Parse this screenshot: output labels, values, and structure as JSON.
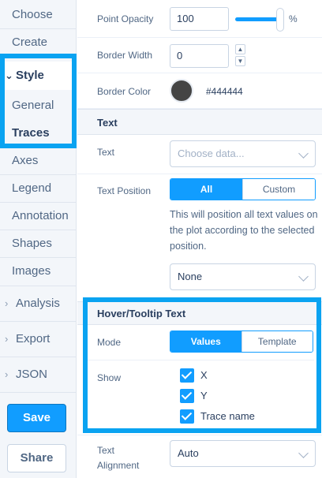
{
  "sidebar": {
    "items": {
      "choose": "Choose",
      "create": "Create",
      "style": "Style",
      "general": "General",
      "traces": "Traces",
      "axes": "Axes",
      "legend": "Legend",
      "annotation": "Annotation",
      "shapes": "Shapes",
      "images": "Images",
      "analysis": "Analysis",
      "export": "Export",
      "json": "JSON"
    },
    "save_label": "Save",
    "share_label": "Share"
  },
  "panel": {
    "point_opacity": {
      "label": "Point Opacity",
      "value": "100",
      "unit": "%",
      "slider_level": 1.0
    },
    "border_width": {
      "label": "Border Width",
      "value": "0"
    },
    "border_color": {
      "label": "Border Color",
      "hex": "#444444"
    },
    "text_section": {
      "title": "Text",
      "text_label": "Text",
      "text_placeholder": "Choose data...",
      "position_label": "Text Position",
      "position_options": [
        "All",
        "Custom"
      ],
      "position_selected": "All",
      "position_help": "This will position all text values on the plot according to the selected position.",
      "position_value": "None"
    },
    "hover_section": {
      "title": "Hover/Tooltip Text",
      "mode_label": "Mode",
      "mode_options": [
        "Values",
        "Template"
      ],
      "mode_selected": "Values",
      "show_label": "Show",
      "show_items": [
        "X",
        "Y",
        "Trace name"
      ]
    },
    "text_alignment": {
      "label_line1": "Text",
      "label_line2": "Alignment",
      "value": "Auto"
    }
  },
  "colors": {
    "accent": "#119dff",
    "highlight": "#0aa3f1",
    "swatch": "#444444"
  }
}
